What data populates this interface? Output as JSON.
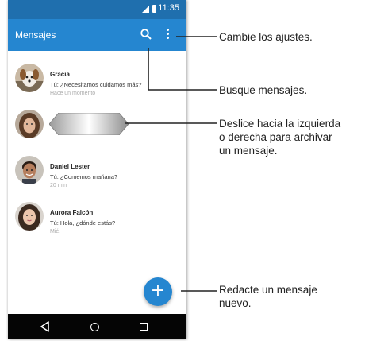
{
  "status_bar": {
    "time": "11:35",
    "color": "#1f6fae"
  },
  "app_bar": {
    "title": "Mensajes",
    "color": "#2586d0",
    "search_icon": "search-icon",
    "menu_icon": "overflow-menu-icon"
  },
  "conversations": [
    {
      "name": "Gracia",
      "preview": "Tú: ¿Necesitamos cuidamos más?",
      "time": "Hace un momento",
      "avatar": "dog-photo"
    },
    {
      "name": "",
      "preview": "",
      "time": "",
      "avatar": "woman-photo",
      "swiping": true
    },
    {
      "name": "Daniel Lester",
      "preview": "Tú: ¿Comemos mañana?",
      "time": "20 min",
      "avatar": "man-photo"
    },
    {
      "name": "Aurora Falcón",
      "preview": "Tú: Hola, ¿dónde estás?",
      "time": "Mié.",
      "avatar": "woman-photo"
    }
  ],
  "fab": {
    "label": "+",
    "icon": "plus-icon"
  },
  "nav_bar": {
    "back_icon": "back-icon",
    "home_icon": "home-icon",
    "recents_icon": "recents-icon"
  },
  "callouts": {
    "settings": "Cambie los ajustes.",
    "search": "Busque mensajes.",
    "swipe": "Deslice hacia la izquierda\no derecha para archivar\nun mensaje.",
    "compose": "Redacte un mensaje\nnuevo."
  }
}
